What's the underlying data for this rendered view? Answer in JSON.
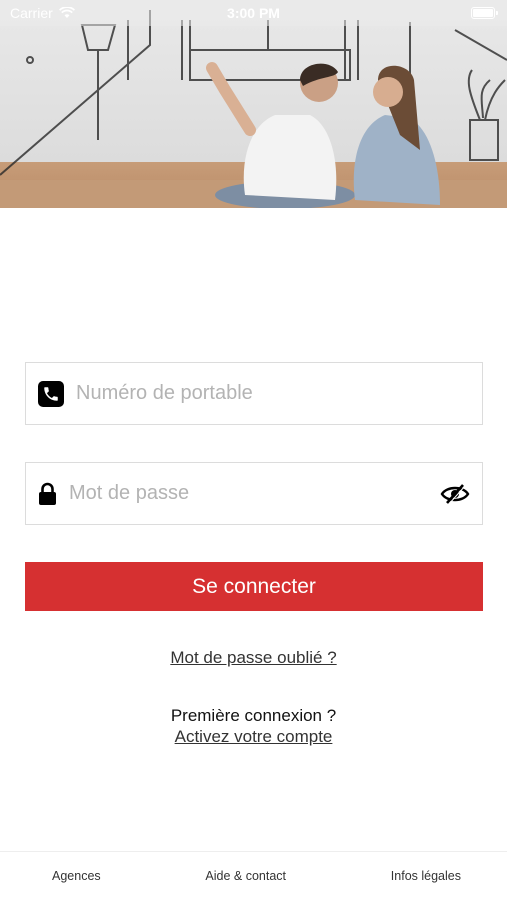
{
  "status_bar": {
    "carrier": "Carrier",
    "time": "3:00 PM"
  },
  "hero": {
    "image_name": "couple-planning-room-sketch"
  },
  "login_form": {
    "phone_placeholder": "Numéro de portable",
    "phone_value": "",
    "password_placeholder": "Mot de passe",
    "password_value": "",
    "submit_label": "Se connecter",
    "forgot_password_link": "Mot de passe oublié ?",
    "first_login_question": "Première connexion ?",
    "activate_account_link": "Activez votre compte"
  },
  "icons": {
    "phone": "phone-icon",
    "lock": "lock-icon",
    "password_visibility": "eye-slash-icon"
  },
  "tab_bar": {
    "items": [
      {
        "label": "Agences"
      },
      {
        "label": "Aide & contact"
      },
      {
        "label": "Infos légales"
      }
    ]
  },
  "colors": {
    "primary": "#d63031",
    "field_border": "#dcdcdc",
    "placeholder": "#b3b3b3",
    "link": "#333333"
  }
}
